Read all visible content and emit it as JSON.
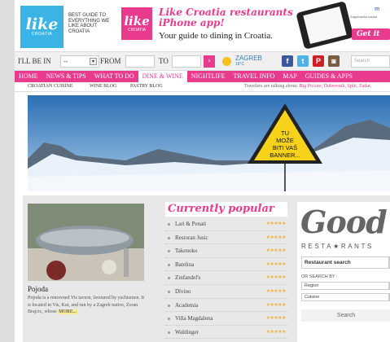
{
  "header": {
    "logo_word": "like",
    "logo_sub": "CROATIA",
    "tagline": "BEST GUIDE TO EVERYTHING WE LIKE ABOUT CROATIA",
    "promo_box_word": "like",
    "promo_box_sub": "CROATIA",
    "promo_title": "Like Croatia restaurants iPhone app!",
    "promo_subtitle": "Your guide to dining in Croatia.",
    "bank_line": "Zagrebačka banka",
    "bank_brand": "m",
    "get_now": "Get it now"
  },
  "search_bar": {
    "in_label": "I'LL BE IN",
    "in_value": "--",
    "from_label": "FROM",
    "to_label": "TO",
    "go_label": "›",
    "city": "ZAGREB",
    "temperature": "18°C",
    "search_placeholder": "Search"
  },
  "social": {
    "facebook": "f",
    "twitter": "t",
    "pinterest": "P",
    "instagram": "◙"
  },
  "nav": {
    "items": [
      "HOME",
      "NEWS & TIPS",
      "WHAT TO DO",
      "DINE & WINE",
      "NIGHTLIFE",
      "TRAVEL INFO",
      "MAP",
      "GUIDES & APPS"
    ],
    "active_index": 3
  },
  "subnav": {
    "items": [
      "CROATIAN CUISINE",
      "WINE BLOG",
      "PASTRY BLOG"
    ],
    "talk_label": "Travelers are talking about:",
    "talk_links": "Big Picture, Dubrovnik, Split, Zadar,"
  },
  "banner": {
    "sign_lines": [
      "TU",
      "MOŽE",
      "BITI VAŠ",
      "BANNER..."
    ]
  },
  "article": {
    "title": "Pojoda",
    "text": "Pojoda is a renowned Vis tavern, favoured by yachtsmen. It is located in Vis, Kut, and run by a Zagreb native, Zoran Brajcic, whose",
    "more_label": "MORE..."
  },
  "popular": {
    "title": "Currently popular",
    "items": [
      "Lari & Penati",
      "Restoran Jusic",
      "Takenoko",
      "Batelina",
      "Zinfandel's",
      "Divino",
      "Academia",
      "Villa Magdalena",
      "Waldinger"
    ],
    "stars": "★★★★★"
  },
  "good_restaurants": {
    "logo_word": "Good",
    "logo_sub": "RESTA★RANTS",
    "search_label": "Restaurant search",
    "or_label": "OR SEARCH BY :",
    "region_label": "Region",
    "cuisine_label": "Cuisine",
    "search_button": "Search"
  },
  "colors": {
    "brand_pink": "#e83b8d",
    "brand_blue": "#3bb4e5"
  }
}
